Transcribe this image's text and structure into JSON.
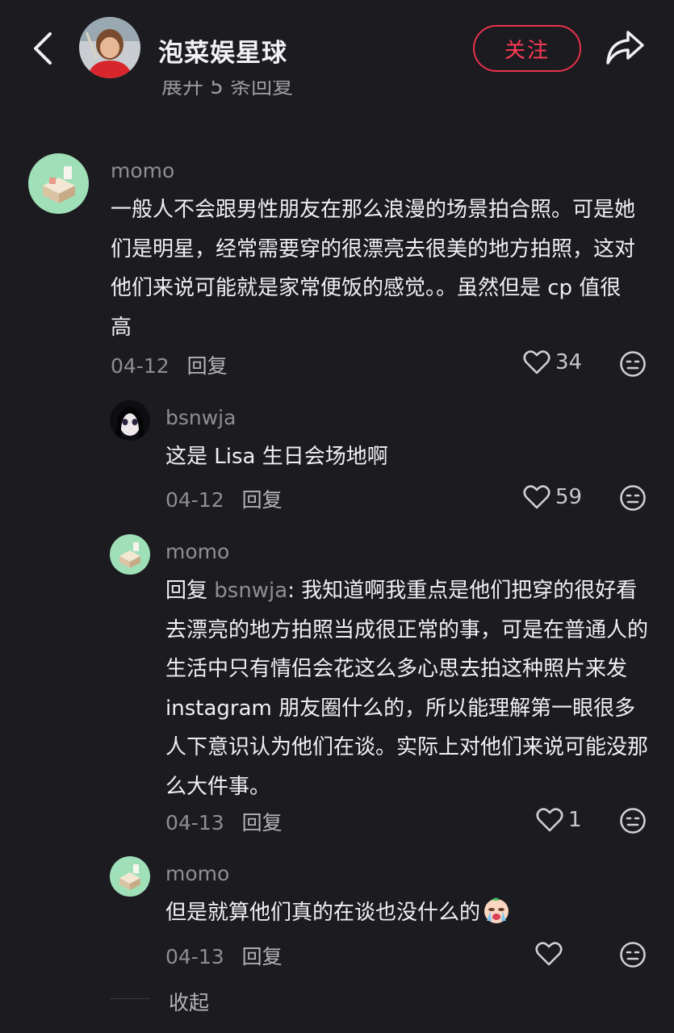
{
  "header": {
    "title": "泡菜娱星球",
    "follow_label": "关注",
    "partial_text": "展开 5 条回复"
  },
  "comments": [
    {
      "user": "momo",
      "text": "一般人不会跟男性朋友在那么浪漫的场景拍合照。可是她们是明星，经常需要穿的很漂亮去很美的地方拍照，这对他们来说可能就是家常便饭的感觉。。虽然但是 cp 值很高",
      "date": "04-12",
      "reply_label": "回复",
      "likes": "34"
    },
    {
      "user": "bsnwja",
      "text": "这是 Lisa 生日会场地啊",
      "date": "04-12",
      "reply_label": "回复",
      "likes": "59"
    },
    {
      "user": "momo",
      "reply_prefix": "回复 ",
      "mention": "bsnwja",
      "text": ": 我知道啊我重点是他们把穿的很好看去漂亮的地方拍照当成很正常的事，可是在普通人的生活中只有情侣会花这么多心思去拍这种照片来发 instagram 朋友圈什么的，所以能理解第一眼很多人下意识认为他们在谈。实际上对他们来说可能没那么大件事。",
      "date": "04-13",
      "reply_label": "回复",
      "likes": "1"
    },
    {
      "user": "momo",
      "text": "但是就算他们真的在谈也没什么的",
      "emoji": "crying-face-emoji",
      "date": "04-13",
      "reply_label": "回复",
      "likes": ""
    }
  ],
  "footer": {
    "collapse_label": "收起"
  },
  "colors": {
    "background": "#1c1b20",
    "accent": "#e8324c",
    "muted": "#8e8e94"
  }
}
